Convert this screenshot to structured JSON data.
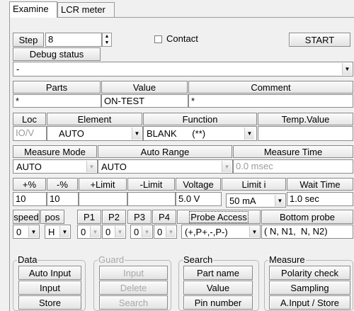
{
  "tabs": [
    {
      "label": "Examine"
    },
    {
      "label": "LCR meter"
    }
  ],
  "top": {
    "step_label": "Step",
    "step_value": "8",
    "contact_label": "Contact",
    "start_label": "START",
    "debug_label": "Debug status",
    "debug_value": "-"
  },
  "parts_row": {
    "headers": [
      "Parts",
      "Value",
      "Comment"
    ],
    "values": [
      "*",
      "ON-TEST",
      "*"
    ]
  },
  "loc_row": {
    "headers": [
      "Loc",
      "Element",
      "Function",
      "Temp.Value"
    ],
    "loc_value": "IO/V",
    "element_value": "AUTO",
    "function_value": "BLANK      (**)",
    "temp_value": ""
  },
  "measure_row": {
    "headers": [
      "Measure Mode",
      "Auto Range",
      "Measure Time"
    ],
    "mode_value": "AUTO",
    "range_value": "AUTO",
    "time_value": "0.0 msec"
  },
  "limit_row": {
    "headers": [
      "+%",
      "-%",
      "+Limit",
      "-Limit",
      "Voltage",
      "Limit i",
      "Wait Time"
    ],
    "plus_pct": "10",
    "minus_pct": "10",
    "plus_limit": "",
    "minus_limit": "",
    "voltage": "5.0 V",
    "limit_i": "50 mA",
    "wait_time": "1.0 sec"
  },
  "probe_row": {
    "headers": [
      "speed",
      "pos",
      "P1",
      "P2",
      "P3",
      "P4",
      "Probe Access",
      "Bottom probe"
    ],
    "speed": "0",
    "pos": "H",
    "p1": "0",
    "p2": "0",
    "p3": "0",
    "p4": "0",
    "probe_access": "(+,P+,-,P-)",
    "bottom_probe": "( N, N1,  N, N2)"
  },
  "groups": {
    "data": {
      "label": "Data",
      "buttons": [
        "Auto Input",
        "Input",
        "Store"
      ]
    },
    "guard": {
      "label": "Guard",
      "buttons": [
        "Input",
        "Delete",
        "Search"
      ]
    },
    "search": {
      "label": "Search",
      "buttons": [
        "Part name",
        "Value",
        "Pin number"
      ]
    },
    "measure": {
      "label": "Measure",
      "buttons": [
        "Polarity check",
        "Sampling",
        "A.Input / Store"
      ]
    }
  }
}
